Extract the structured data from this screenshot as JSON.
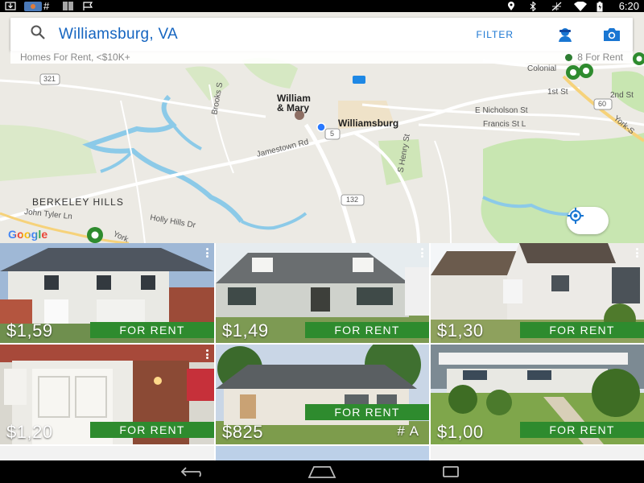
{
  "status_bar": {
    "time": "6:20"
  },
  "search": {
    "query": "Williamsburg, VA",
    "filter_label": "FILTER"
  },
  "subbar": {
    "summary": "Homes For Rent, <$10K+",
    "count_label": "8 For Rent"
  },
  "map": {
    "labels": {
      "w_and_m_1": "William",
      "w_and_m_2": "& Mary",
      "williamsburg": "Williamsburg",
      "berkeley": "BERKELEY HILLS",
      "jamestown": "Jamestown Rd",
      "john_tyler": "John Tyler Ln",
      "holly_hills": "Holly Hills Dr",
      "nicholson": "E Nicholson St",
      "francis": "Francis St L",
      "first_st": "1st St",
      "second_st": "2nd St",
      "colonial": "Colonial",
      "york": "York-S",
      "route_321": "321",
      "route_5": "5",
      "route_132": "132",
      "route_60": "60",
      "henry": "S Henry St",
      "brooks": "Brooks S",
      "yorkt": "York"
    },
    "google": "Google"
  },
  "listings": [
    {
      "price": "$1,59",
      "badge": "FOR RENT"
    },
    {
      "price": "$1,49",
      "badge": "FOR RENT"
    },
    {
      "price": "$1,30",
      "badge": "FOR RENT"
    },
    {
      "price": "$1,20",
      "badge": "FOR RENT"
    },
    {
      "price": "$825",
      "badge": "FOR RENT",
      "tag": "# A"
    },
    {
      "price": "$1,00",
      "badge": "FOR RENT"
    }
  ],
  "colors": {
    "accent": "#1976d2",
    "badge": "#2e8b2e"
  },
  "icons": [
    "search-icon",
    "agent-icon",
    "camera-icon",
    "locate-icon",
    "back-icon",
    "home-icon",
    "recents-icon"
  ]
}
